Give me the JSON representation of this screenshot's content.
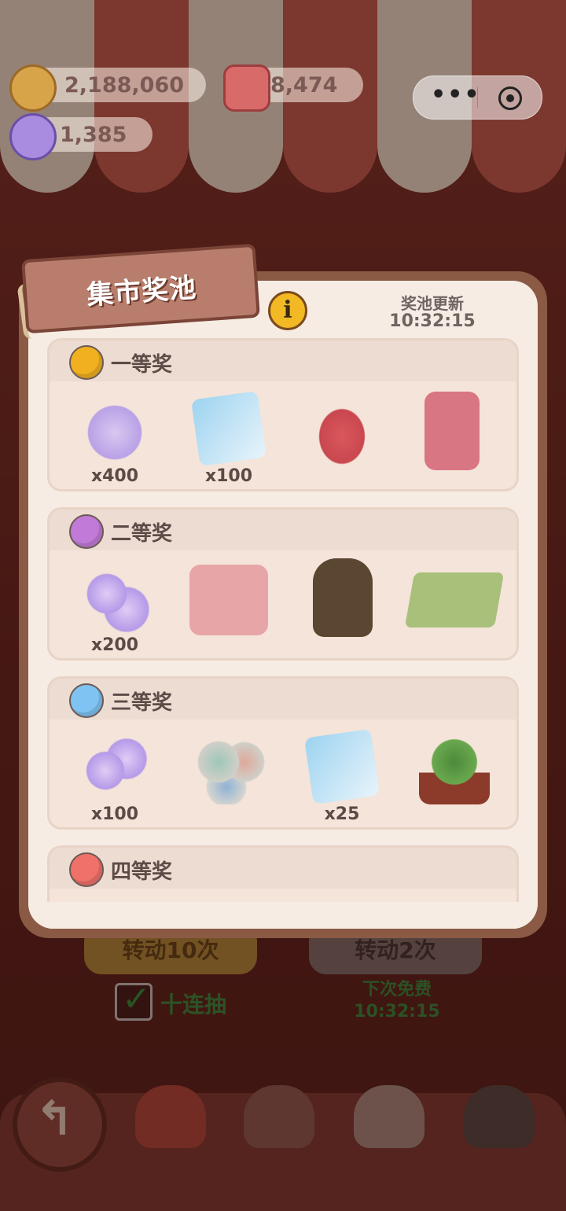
{
  "currencies": {
    "coins": {
      "value": "2,188,060",
      "icon": "cookie-icon"
    },
    "gems": {
      "value": "8,474",
      "icon": "jelly-icon"
    },
    "candies": {
      "value": "1,385",
      "icon": "candy-icon"
    }
  },
  "capsule": {
    "more": "•••"
  },
  "pool": {
    "title": "集市奖池",
    "refresh_label": "奖池更新",
    "refresh_time": "10:32:15",
    "info_icon": "i",
    "tiers": [
      {
        "title": "一等奖",
        "color": "#f0b020",
        "items": [
          {
            "name": "candy-jar-icon",
            "qty": "x400"
          },
          {
            "name": "recipe-book-card-icon",
            "qty": "x100"
          },
          {
            "name": "piano-desk-icon",
            "qty": ""
          },
          {
            "name": "panda-cabinet-icon",
            "qty": ""
          }
        ]
      },
      {
        "title": "二等奖",
        "color": "#c27ad8",
        "items": [
          {
            "name": "candy-pile-icon",
            "qty": "x200"
          },
          {
            "name": "pink-sink-icon",
            "qty": ""
          },
          {
            "name": "lantern-icon",
            "qty": ""
          },
          {
            "name": "low-table-icon",
            "qty": ""
          }
        ]
      },
      {
        "title": "三等奖",
        "color": "#7ec3f2",
        "items": [
          {
            "name": "candy-cluster-icon",
            "qty": "x100"
          },
          {
            "name": "paint-buckets-icon",
            "qty": ""
          },
          {
            "name": "chef-card-icon",
            "qty": "x25"
          },
          {
            "name": "flower-stand-icon",
            "qty": ""
          }
        ]
      },
      {
        "title": "四等奖",
        "color": "#f0706a",
        "items": []
      }
    ]
  },
  "actions": {
    "spin10_label": "转动10次",
    "spin2_label": "转动2次",
    "ten_draw_label": "十连抽",
    "free_label": "下次免费",
    "free_time": "10:32:15"
  }
}
